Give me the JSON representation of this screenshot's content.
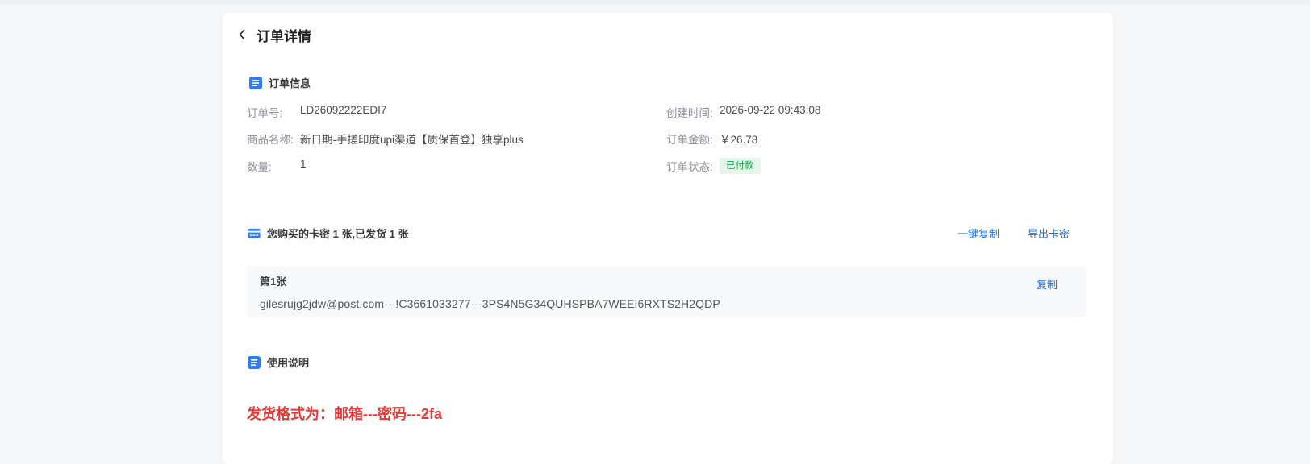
{
  "header": {
    "title": "订单详情"
  },
  "order_info": {
    "section_title": "订单信息",
    "order_no_label": "订单号:",
    "order_no": "LD26092222EDI7",
    "product_label": "商品名称:",
    "product": "新日期-手搓印度upi渠道【质保首登】独享plus",
    "qty_label": "数量:",
    "qty": "1",
    "created_label": "创建时间:",
    "created": "2026-09-22 09:43:08",
    "amount_label": "订单金额:",
    "amount": "￥26.78",
    "status_label": "订单状态:",
    "status": "已付款"
  },
  "cards": {
    "section_title": "您购买的卡密 1 张,已发货 1 张",
    "copy_all": "一键复制",
    "export": "导出卡密",
    "items": [
      {
        "index_label": "第1张",
        "content": "gilesrujg2jdw@post.com---!C3661033277---3PS4N5G34QUHSPBA7WEEI6RXTS2H2QDP",
        "copy_label": "复制"
      }
    ]
  },
  "usage": {
    "section_title": "使用说明",
    "text": "发货格式为：邮箱---密码---2fa"
  },
  "colors": {
    "accent": "#1a6fe0",
    "success": "#1aa34a",
    "danger": "#e53935",
    "icon_blue": "#2f7cf6"
  }
}
